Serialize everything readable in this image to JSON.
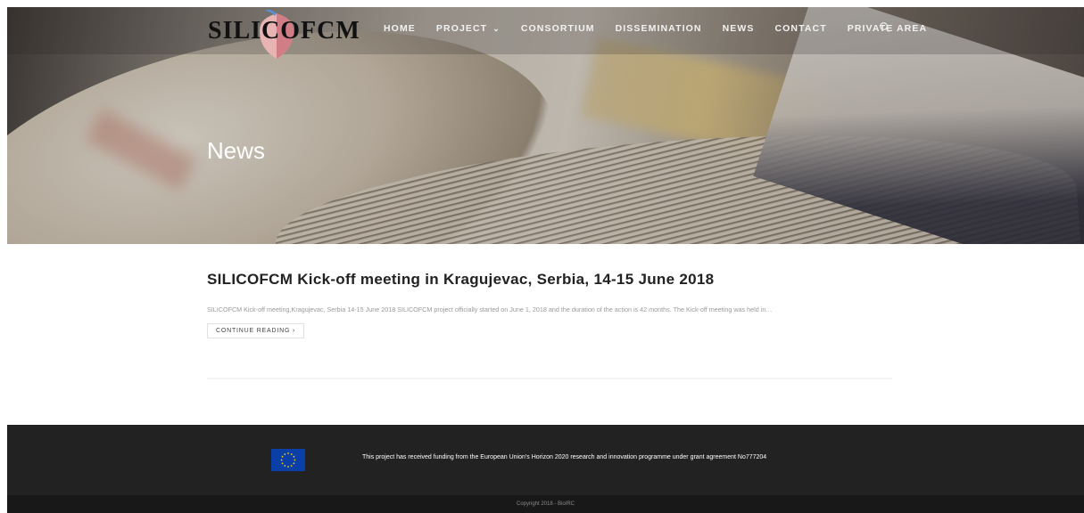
{
  "brand": {
    "logo_text_left": "SILI",
    "logo_text_mid": "CO",
    "logo_text_right": "FCM"
  },
  "nav": {
    "items": [
      {
        "label": "HOME"
      },
      {
        "label": "PROJECT"
      },
      {
        "label": "CONSORTIUM"
      },
      {
        "label": "DISSEMINATION"
      },
      {
        "label": "NEWS"
      },
      {
        "label": "CONTACT"
      },
      {
        "label": "PRIVATE AREA"
      }
    ],
    "project_chevron": "⌄",
    "search_icon": "search-icon"
  },
  "hero": {
    "title": "News"
  },
  "post": {
    "title": "SILICOFCM Kick-off meeting in Kragujevac, Serbia, 14-15 June 2018",
    "excerpt": "SILICOFCM Kick-off meeting,Kragujevac, Serbia 14-15 June 2018 SILICOFCM project officially started on June 1, 2018 and the duration of the action is 42 months. The Kick-off meeting was held in…",
    "continue_label": "CONTINUE READING ›"
  },
  "footer": {
    "funding_text": "This project has received funding from the European Union’s Horizon 2020 research and innovation programme under grant agreement No777204",
    "copyright": "Copyright 2018 - BioIRC"
  },
  "colors": {
    "footer_top": "#222222",
    "footer_bottom": "#181818",
    "eu_blue": "#0b3fa8",
    "eu_star": "#ffcc00"
  }
}
